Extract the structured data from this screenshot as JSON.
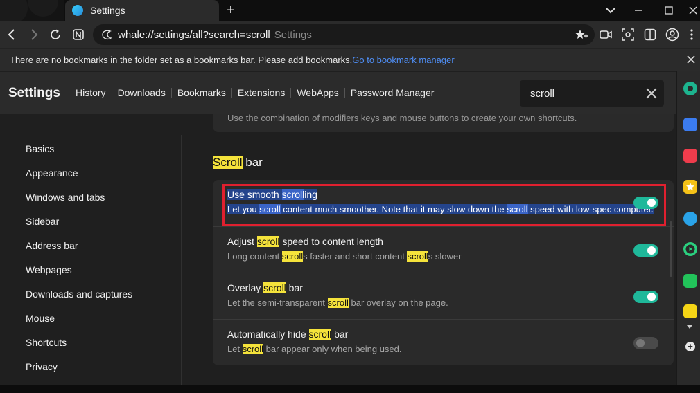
{
  "browser": {
    "tab_title": "Settings",
    "url": "whale://settings/all?search=scroll",
    "url_hint": "Settings",
    "new_tab_symbol": "+",
    "window_controls": [
      "chevron-down",
      "minimize",
      "maximize",
      "close"
    ]
  },
  "bookmark_bar": {
    "message": "There are no bookmarks in the folder set as a bookmarks bar. Please add bookmarks.",
    "link": "Go to bookmark manager"
  },
  "settings": {
    "title": "Settings",
    "nav": [
      "History",
      "Downloads",
      "Bookmarks",
      "Extensions",
      "WebApps",
      "Password Manager"
    ],
    "search_value": "scroll"
  },
  "sidebar": {
    "items": [
      "Basics",
      "Appearance",
      "Windows and tabs",
      "Sidebar",
      "Address bar",
      "Webpages",
      "Downloads and captures",
      "Mouse",
      "Shortcuts",
      "Privacy"
    ]
  },
  "content": {
    "prev_card_text": "Use the combination of modifiers keys and mouse buttons to create your own shortcuts.",
    "section": {
      "highlight": "Scroll",
      "rest": " bar"
    },
    "rows": [
      {
        "title": [
          "Use smooth ",
          "scroll",
          "ing"
        ],
        "desc": [
          "Let you ",
          "scroll",
          " content much smoother. Note that it may slow down the ",
          "scroll",
          " speed with low-spec computer."
        ],
        "enabled": true
      },
      {
        "title": [
          "Adjust ",
          "scroll",
          " speed to content length"
        ],
        "desc": [
          "Long content ",
          "scroll",
          "s faster and short content ",
          "scroll",
          "s slower"
        ],
        "enabled": true
      },
      {
        "title": [
          "Overlay ",
          "scroll",
          " bar"
        ],
        "desc": [
          "Let the semi-transparent ",
          "scroll",
          " bar overlay on the page."
        ],
        "enabled": true
      },
      {
        "title": [
          "Automatically hide ",
          "scroll",
          " bar"
        ],
        "desc": [
          "Let ",
          "scroll",
          " bar appear only when being used."
        ],
        "enabled": false
      }
    ]
  },
  "colors": {
    "accent_toggle": "#1fb89a",
    "search_highlight": "#f5e33b",
    "selection": "#24448c",
    "annotation_box": "#e0202f",
    "link": "#4f8ff7"
  }
}
